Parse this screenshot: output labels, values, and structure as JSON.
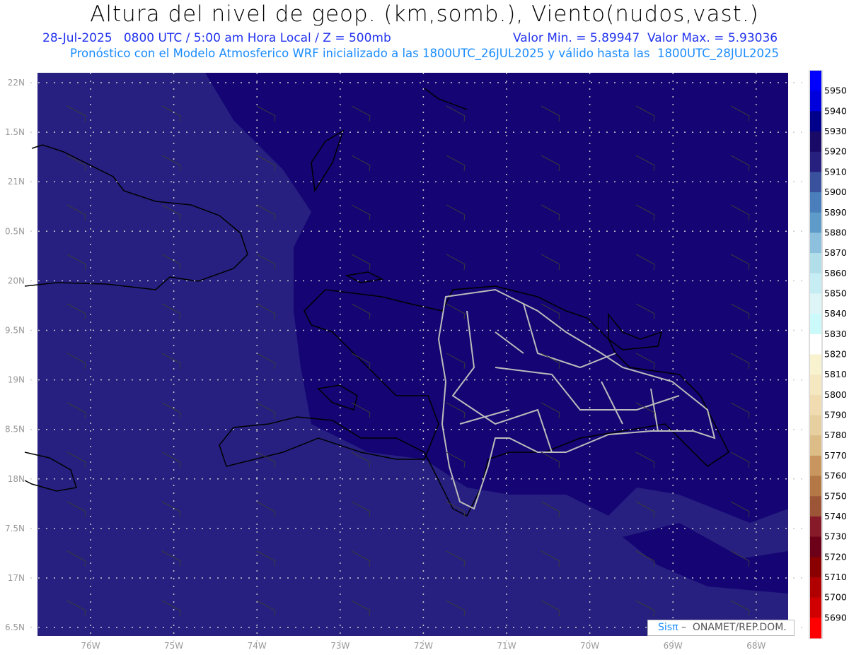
{
  "header": {
    "title": "Altura del nivel de geop. (km,somb.), Viento(nudos,vast.)",
    "date_line": "28-Jul-2025   0800 UTC / 5:00 am Hora Local / Z = 500mb",
    "minmax_line": "Valor Min. = 5.89947  Valor Max. = 5.93036",
    "model_line": "Pronóstico con el Modelo Atmosferico WRF inicializado a las 1800UTC_26JUL2025 y válido hasta las  1800UTC_28JUL2025"
  },
  "map": {
    "lat_labels": [
      "22N",
      "1.5N",
      "21N",
      "0.5N",
      "20N",
      "9.5N",
      "19N",
      "8.5N",
      "18N",
      "7.5N",
      "17N",
      "6.5N"
    ],
    "lon_labels": [
      "76W",
      "75W",
      "74W",
      "73W",
      "72W",
      "71W",
      "70W",
      "69W",
      "68W"
    ],
    "colors": {
      "high_region": "#140474",
      "low_region": "#272080",
      "coast": "#000000",
      "provinces": "#bbbbbb",
      "grid": "#cccccc"
    }
  },
  "colorbar": {
    "labels": [
      "5950",
      "5940",
      "5930",
      "5920",
      "5910",
      "5900",
      "5890",
      "5880",
      "5870",
      "5860",
      "5850",
      "5840",
      "5830",
      "5820",
      "5810",
      "5800",
      "5790",
      "5780",
      "5770",
      "5760",
      "5750",
      "5740",
      "5730",
      "5720",
      "5710",
      "5700",
      "5690"
    ],
    "colors": [
      "#0000ff",
      "#0000dd",
      "#00008b",
      "#180a66",
      "#28207e",
      "#3a529e",
      "#4a7fbb",
      "#5f9bc8",
      "#8cc0dc",
      "#b2deea",
      "#c6edf3",
      "#def5f8",
      "#ccfafa",
      "#ffffff",
      "#f8f2cf",
      "#f5e8c1",
      "#f0dcb0",
      "#e8cf9f",
      "#dcbd87",
      "#c8965e",
      "#b47746",
      "#9c5536",
      "#861a28",
      "#6c0018",
      "#8a0000",
      "#b00000",
      "#d00000",
      "#ff0000"
    ]
  },
  "footer": {
    "logo_brand": "Sisπ",
    "logo_text": " –  ONAMET/REP.DOM."
  }
}
